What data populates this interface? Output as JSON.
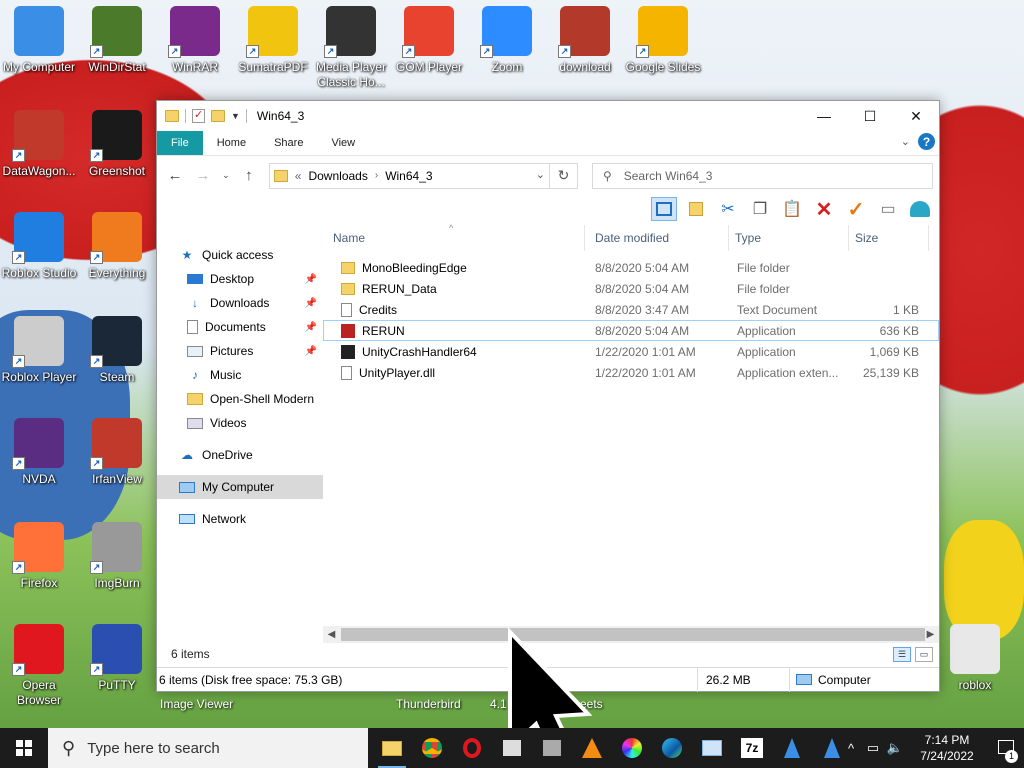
{
  "desktop": {
    "icons": [
      {
        "label": "My Computer",
        "icon": "computer-icon",
        "color": "#3a8ee6"
      },
      {
        "label": "WinDirStat",
        "icon": "tree-icon",
        "color": "#4b7a2a"
      },
      {
        "label": "WinRAR",
        "icon": "winrar-icon",
        "color": "#7a2a8a"
      },
      {
        "label": "SumatraPDF",
        "icon": "pdf-icon",
        "color": "#f1c40f"
      },
      {
        "label": "Media Player Classic Ho...",
        "icon": "media-player-icon",
        "color": "#333333"
      },
      {
        "label": "GOM Player",
        "icon": "gom-player-icon",
        "color": "#e8432f"
      },
      {
        "label": "Zoom",
        "icon": "zoom-icon",
        "color": "#2d8cff"
      },
      {
        "label": "download",
        "icon": "roblox-thumbnail-icon",
        "color": "#b33a2a"
      },
      {
        "label": "Google Slides",
        "icon": "google-slides-icon",
        "color": "#f4b400"
      },
      {
        "label": "DataWagon...",
        "icon": "datawagon-icon",
        "color": "#c0392b"
      },
      {
        "label": "Greenshot",
        "icon": "greenshot-icon",
        "color": "#1a1a1a"
      },
      {
        "label": "Roblox Studio",
        "icon": "roblox-studio-icon",
        "color": "#1f7ee0"
      },
      {
        "label": "Everything",
        "icon": "everything-search-icon",
        "color": "#f07b1f"
      },
      {
        "label": "Roblox Player",
        "icon": "roblox-player-icon",
        "color": "#cccccc"
      },
      {
        "label": "Steam",
        "icon": "steam-icon",
        "color": "#1b2838"
      },
      {
        "label": "NVDA",
        "icon": "nvda-icon",
        "color": "#5a2d82"
      },
      {
        "label": "IrfanView",
        "icon": "irfanview-icon",
        "color": "#c0392b"
      },
      {
        "label": "Firefox",
        "icon": "firefox-icon",
        "color": "#ff7139"
      },
      {
        "label": "ImgBurn",
        "icon": "imgburn-icon",
        "color": "#999999"
      },
      {
        "label": "Opera Browser",
        "icon": "opera-icon",
        "color": "#e0171f"
      },
      {
        "label": "PuTTY",
        "icon": "putty-icon",
        "color": "#2a4fb0"
      },
      {
        "label": "roblox",
        "icon": "recycle-bin-icon",
        "color": "#e8e8e8"
      }
    ],
    "behind_labels": [
      "Image Viewer",
      "Thunderbird",
      "4.1",
      "eets"
    ]
  },
  "window": {
    "title": "Win64_3",
    "ribbon_tabs": [
      "File",
      "Home",
      "Share",
      "View"
    ],
    "address": {
      "prefix": "«",
      "crumbs": [
        "Downloads",
        "Win64_3"
      ]
    },
    "search_placeholder": "Search Win64_3",
    "nav": {
      "quick_access": "Quick access",
      "pinned": [
        "Desktop",
        "Downloads",
        "Documents",
        "Pictures"
      ],
      "others": [
        "Music",
        "Open-Shell Modern",
        "Videos"
      ],
      "onedrive": "OneDrive",
      "my_computer": "My Computer",
      "network": "Network"
    },
    "columns": [
      "Name",
      "Date modified",
      "Type",
      "Size"
    ],
    "files": [
      {
        "name": "MonoBleedingEdge",
        "date": "8/8/2020 5:04 AM",
        "type": "File folder",
        "size": "",
        "kind": "folder"
      },
      {
        "name": "RERUN_Data",
        "date": "8/8/2020 5:04 AM",
        "type": "File folder",
        "size": "",
        "kind": "folder"
      },
      {
        "name": "Credits",
        "date": "8/8/2020 3:47 AM",
        "type": "Text Document",
        "size": "1 KB",
        "kind": "doc"
      },
      {
        "name": "RERUN",
        "date": "8/8/2020 5:04 AM",
        "type": "Application",
        "size": "636 KB",
        "kind": "app-red"
      },
      {
        "name": "UnityCrashHandler64",
        "date": "1/22/2020 1:01 AM",
        "type": "Application",
        "size": "1,069 KB",
        "kind": "app-dark"
      },
      {
        "name": "UnityPlayer.dll",
        "date": "1/22/2020 1:01 AM",
        "type": "Application exten...",
        "size": "25,139 KB",
        "kind": "doc"
      }
    ],
    "selected_row": 3,
    "status_items": "6 items",
    "details_left": "6 items (Disk free space: 75.3 GB)",
    "details_size": "26.2 MB",
    "details_location": "Computer"
  },
  "taskbar": {
    "search_placeholder": "Type here to search",
    "time": "7:14 PM",
    "date": "7/24/2022",
    "notifications": "1"
  }
}
